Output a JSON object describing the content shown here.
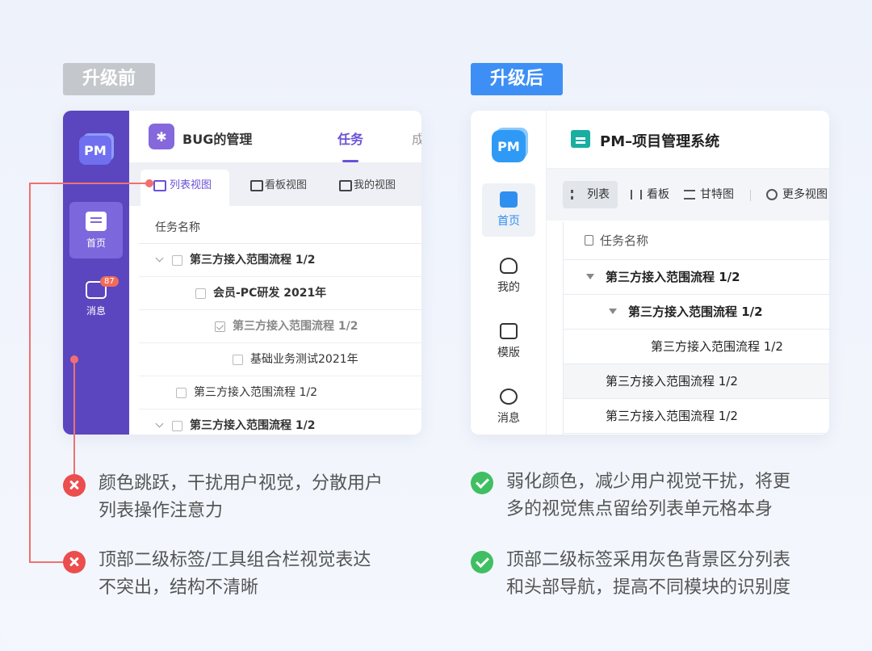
{
  "before_label": "升级前",
  "after_label": "升级后",
  "before": {
    "logo": "PM",
    "nav": [
      {
        "label": "首页"
      },
      {
        "label": "消息",
        "badge": "87"
      }
    ],
    "project_title": "BUG的管理",
    "tabs": [
      "任务",
      "成"
    ],
    "views": [
      "列表视图",
      "看板视图",
      "我的视图"
    ],
    "table_header": "任务名称",
    "rows": [
      {
        "text": "第三方接入范围流程 1/2"
      },
      {
        "text": "会员-PC研发 2021年"
      },
      {
        "text": "第三方接入范围流程 1/2"
      },
      {
        "text": "基础业务测试2021年"
      },
      {
        "text": "第三方接入范围流程 1/2"
      },
      {
        "text": "第三方接入范围流程 1/2"
      }
    ]
  },
  "after": {
    "logo": "PM",
    "nav": [
      {
        "label": "首页"
      },
      {
        "label": "我的"
      },
      {
        "label": "模版"
      },
      {
        "label": "消息"
      }
    ],
    "project_title": "PM–项目管理系统",
    "toolbar": [
      "列表",
      "看板",
      "甘特图",
      "更多视图"
    ],
    "table_header": "任务名称",
    "rows": [
      {
        "text": "第三方接入范围流程 1/2"
      },
      {
        "text": "第三方接入范围流程 1/2"
      },
      {
        "text": "第三方接入范围流程 1/2"
      },
      {
        "text": "第三方接入范围流程 1/2"
      },
      {
        "text": "第三方接入范围流程 1/2"
      }
    ]
  },
  "notes_before": [
    {
      "line1": "颜色跳跃，干扰用户视觉，分散用户",
      "line2": "列表操作注意力"
    },
    {
      "line1": "顶部二级标签/工具组合栏视觉表达",
      "line2": "不突出，结构不清晰"
    }
  ],
  "notes_after": [
    {
      "line1": "弱化颜色，减少用户视觉干扰，将更",
      "line2": "多的视觉焦点留给列表单元格本身"
    },
    {
      "line1": "顶部二级标签采用灰色背景区分列表",
      "line2": "和头部导航，提高不同模块的识别度"
    }
  ],
  "colors": {
    "before_accent": "#5b46c0",
    "after_accent": "#3d8ff5",
    "error": "#ec4d4d",
    "ok": "#3fbf62"
  }
}
